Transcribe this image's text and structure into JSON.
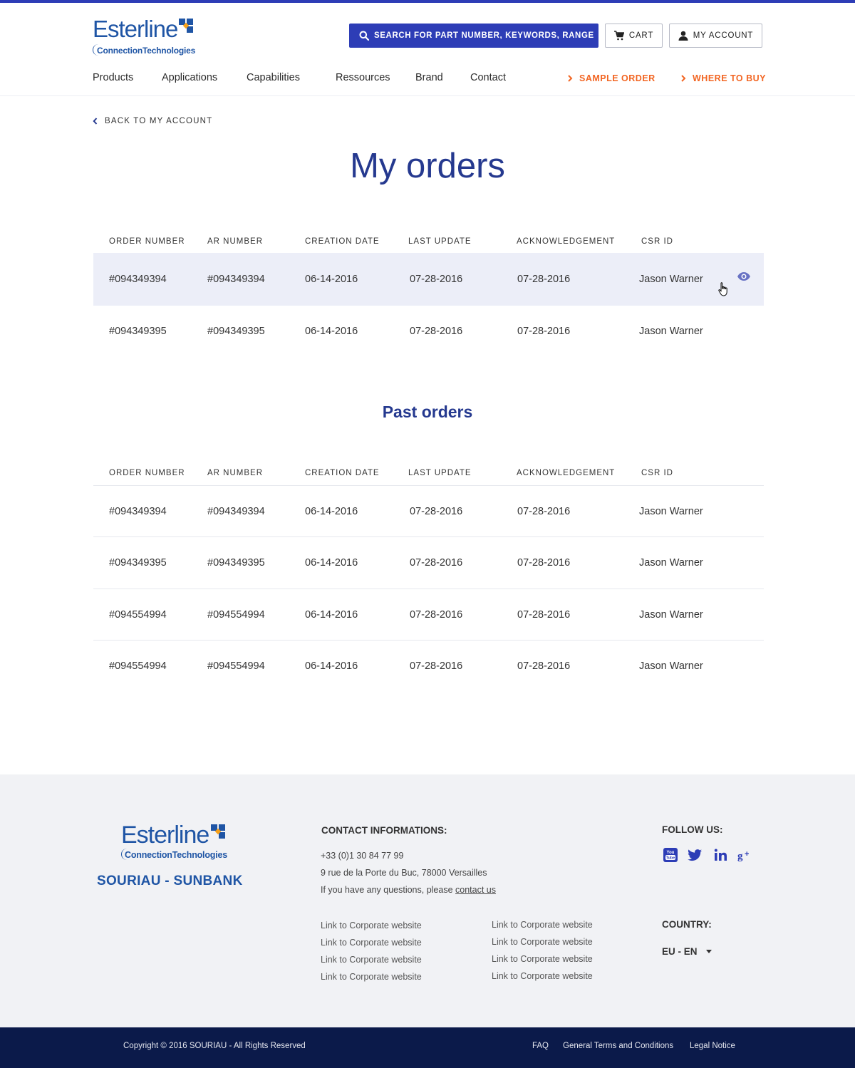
{
  "brand": {
    "logo_word": "Esterline",
    "logo_sub": "ConnectionTechnologies",
    "footer_brand": "SOURIAU - SUNBANK",
    "accent": "#2d3db6",
    "orange": "#f26522",
    "title_color": "#25398f"
  },
  "header": {
    "search_placeholder": "SEARCH FOR PART NUMBER, KEYWORDS, RANGE",
    "cart_label": "CART",
    "account_label": "MY ACCOUNT"
  },
  "nav": {
    "items": [
      "Products",
      "Applications",
      "Capabilities",
      "Ressources",
      "Brand",
      "Contact"
    ],
    "sample_order": "SAMPLE ORDER",
    "where_to_buy": "WHERE TO BUY"
  },
  "main": {
    "back_label": "BACK TO MY ACCOUNT",
    "title": "My orders",
    "past_title": "Past orders",
    "columns": [
      "ORDER NUMBER",
      "AR NUMBER",
      "CREATION DATE",
      "LAST UPDATE",
      "ACKNOWLEDGEMENT",
      "CSR ID"
    ],
    "current_orders": [
      [
        "#094349394",
        "#094349394",
        "06-14-2016",
        "07-28-2016",
        "07-28-2016",
        "Jason Warner"
      ],
      [
        "#094349395",
        "#094349395",
        "06-14-2016",
        "07-28-2016",
        "07-28-2016",
        "Jason Warner"
      ]
    ],
    "past_orders": [
      [
        "#094349394",
        "#094349394",
        "06-14-2016",
        "07-28-2016",
        "07-28-2016",
        "Jason Warner"
      ],
      [
        "#094349395",
        "#094349395",
        "06-14-2016",
        "07-28-2016",
        "07-28-2016",
        "Jason Warner"
      ],
      [
        "#094554994",
        "#094554994",
        "06-14-2016",
        "07-28-2016",
        "07-28-2016",
        "Jason Warner"
      ],
      [
        "#094554994",
        "#094554994",
        "06-14-2016",
        "07-28-2016",
        "07-28-2016",
        "Jason Warner"
      ]
    ]
  },
  "footer": {
    "contact_heading": "CONTACT INFORMATIONS:",
    "phone": "+33 (0)1 30 84 77 99",
    "address": "9 rue de la Porte du Buc, 78000 Versailles",
    "question_text": "If you have any questions, please",
    "contact_link": "contact us",
    "links_col1": [
      "Link to Corporate website",
      "Link to Corporate website",
      "Link to Corporate website",
      "Link to Corporate website"
    ],
    "links_col2": [
      "Link to Corporate website",
      "Link to Corporate website",
      "Link to Corporate website",
      "Link to Corporate website"
    ],
    "follow_heading": "FOLLOW US:",
    "social_icons": [
      "youtube-icon",
      "twitter-icon",
      "linkedin-icon",
      "google-plus-icon"
    ],
    "country_heading": "COUNTRY:",
    "country_value": "EU - EN"
  },
  "bottom": {
    "copyright": "Copyright © 2016 SOURIAU - All Rights Reserved",
    "faq": "FAQ",
    "terms": "General Terms and Conditions",
    "legal": "Legal Notice"
  }
}
